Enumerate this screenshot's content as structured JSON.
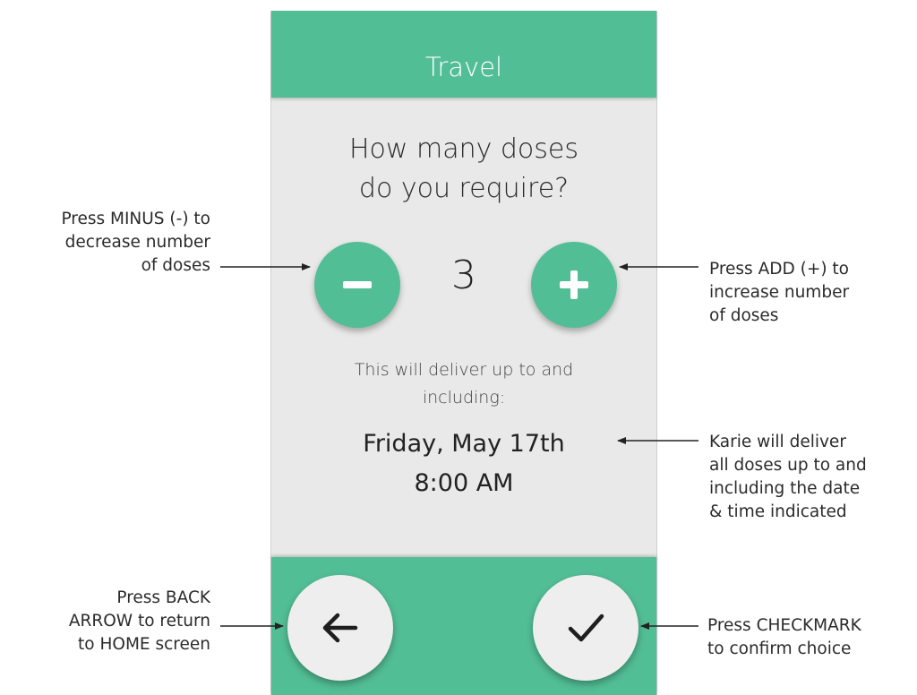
{
  "screen": {
    "title": "Travel",
    "question_lines": [
      "How many doses",
      "do you require?"
    ],
    "dose_count": "3",
    "deliver_lines": [
      "This will deliver up to and",
      "including:"
    ],
    "date_lines": [
      "Friday, May 17th",
      "8:00 AM"
    ]
  },
  "annotations": {
    "minus": [
      "Press MINUS (-) to",
      "decrease number",
      "of doses"
    ],
    "add": [
      "Press ADD (+) to",
      "increase number",
      "of doses"
    ],
    "deliver": [
      "Karie will deliver",
      "all doses up to and",
      "including the date",
      "& time indicated"
    ],
    "back": [
      "Press BACK",
      "ARROW to return",
      "to HOME screen"
    ],
    "check": [
      "Press CHECKMARK",
      "to confirm choice"
    ]
  },
  "icons": {
    "minus": "minus-icon",
    "plus": "plus-icon",
    "back": "arrow-left-icon",
    "check": "checkmark-icon"
  },
  "colors": {
    "accent_green": "#52be95",
    "screen_bg": "#e9e9e9",
    "button_light": "#eeeeee"
  }
}
